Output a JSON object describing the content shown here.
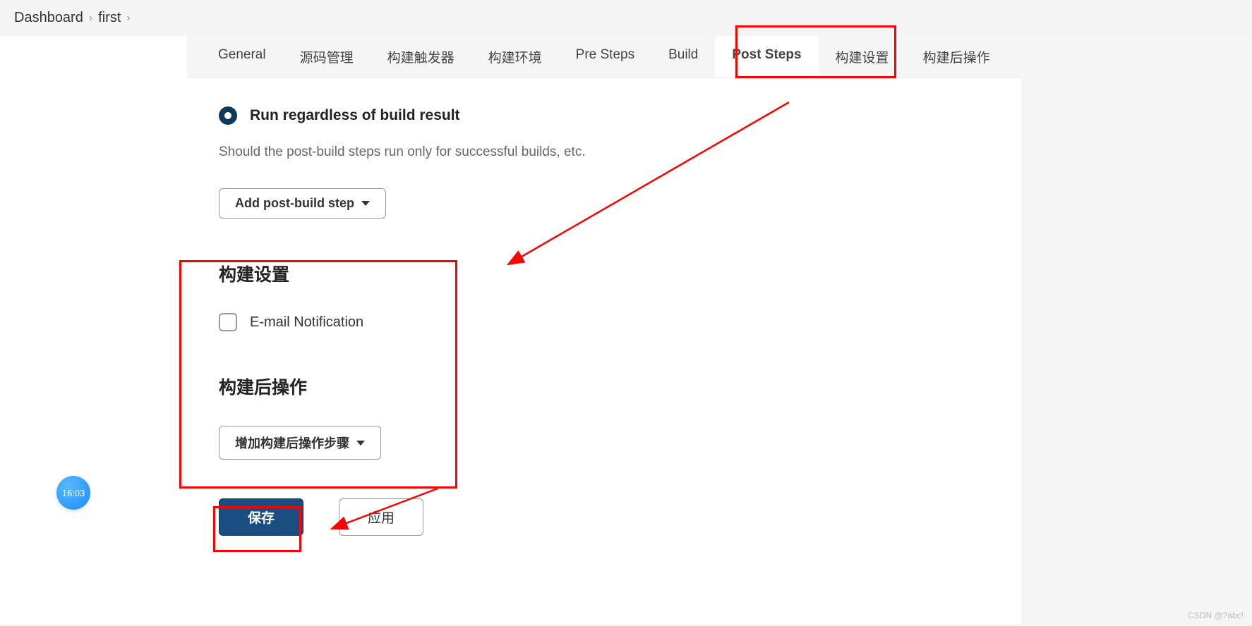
{
  "breadcrumb": {
    "items": [
      "Dashboard",
      "first"
    ]
  },
  "tabs": {
    "items": [
      {
        "label": "General"
      },
      {
        "label": "源码管理"
      },
      {
        "label": "构建触发器"
      },
      {
        "label": "构建环境"
      },
      {
        "label": "Pre Steps"
      },
      {
        "label": "Build"
      },
      {
        "label": "Post Steps"
      },
      {
        "label": "构建设置"
      },
      {
        "label": "构建后操作"
      }
    ],
    "active_index": 6
  },
  "post_steps": {
    "radio_label": "Run regardless of build result",
    "help_text": "Should the post-build steps run only for successful builds, etc.",
    "add_button": "Add post-build step"
  },
  "build_settings": {
    "title": "构建设置",
    "email_label": "E-mail Notification"
  },
  "post_build": {
    "title": "构建后操作",
    "add_button": "增加构建后操作步骤"
  },
  "buttons": {
    "save": "保存",
    "apply": "应用"
  },
  "clock": {
    "time": "16:03"
  },
  "watermark": "CSDN @?abc!"
}
